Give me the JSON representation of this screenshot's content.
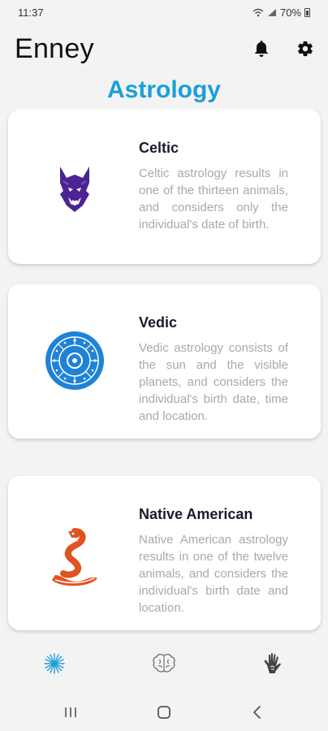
{
  "status_bar": {
    "time": "11:37",
    "battery": "70%"
  },
  "header": {
    "title": "Enney",
    "notification_icon": "bell-icon",
    "settings_icon": "gear-icon"
  },
  "section": {
    "title": "Astrology"
  },
  "cards": [
    {
      "title": "Celtic",
      "description": "Celtic astrology results in one of the thirteen animals, and considers only the individual's date of birth.",
      "icon": "wolf-icon",
      "color": "#5b2aa0"
    },
    {
      "title": "Vedic",
      "description": "Vedic astrology consists of the sun and the visible planets, and considers the individual's birth date, time and location.",
      "icon": "zodiac-wheel-icon",
      "color": "#1e83d6"
    },
    {
      "title": "Native American",
      "description": "Native American astrology results in one of the twelve animals, and considers the individual's birth date and location.",
      "icon": "snake-icon",
      "color": "#e0531f"
    }
  ],
  "bottom_nav": [
    {
      "name": "astrology",
      "icon": "sparkle-icon",
      "active": true
    },
    {
      "name": "brain",
      "icon": "brain-icon",
      "active": false
    },
    {
      "name": "palmistry",
      "icon": "palm-icon",
      "active": false
    }
  ],
  "colors": {
    "accent": "#1b9fd8",
    "card_text": "#a9a9a9"
  }
}
